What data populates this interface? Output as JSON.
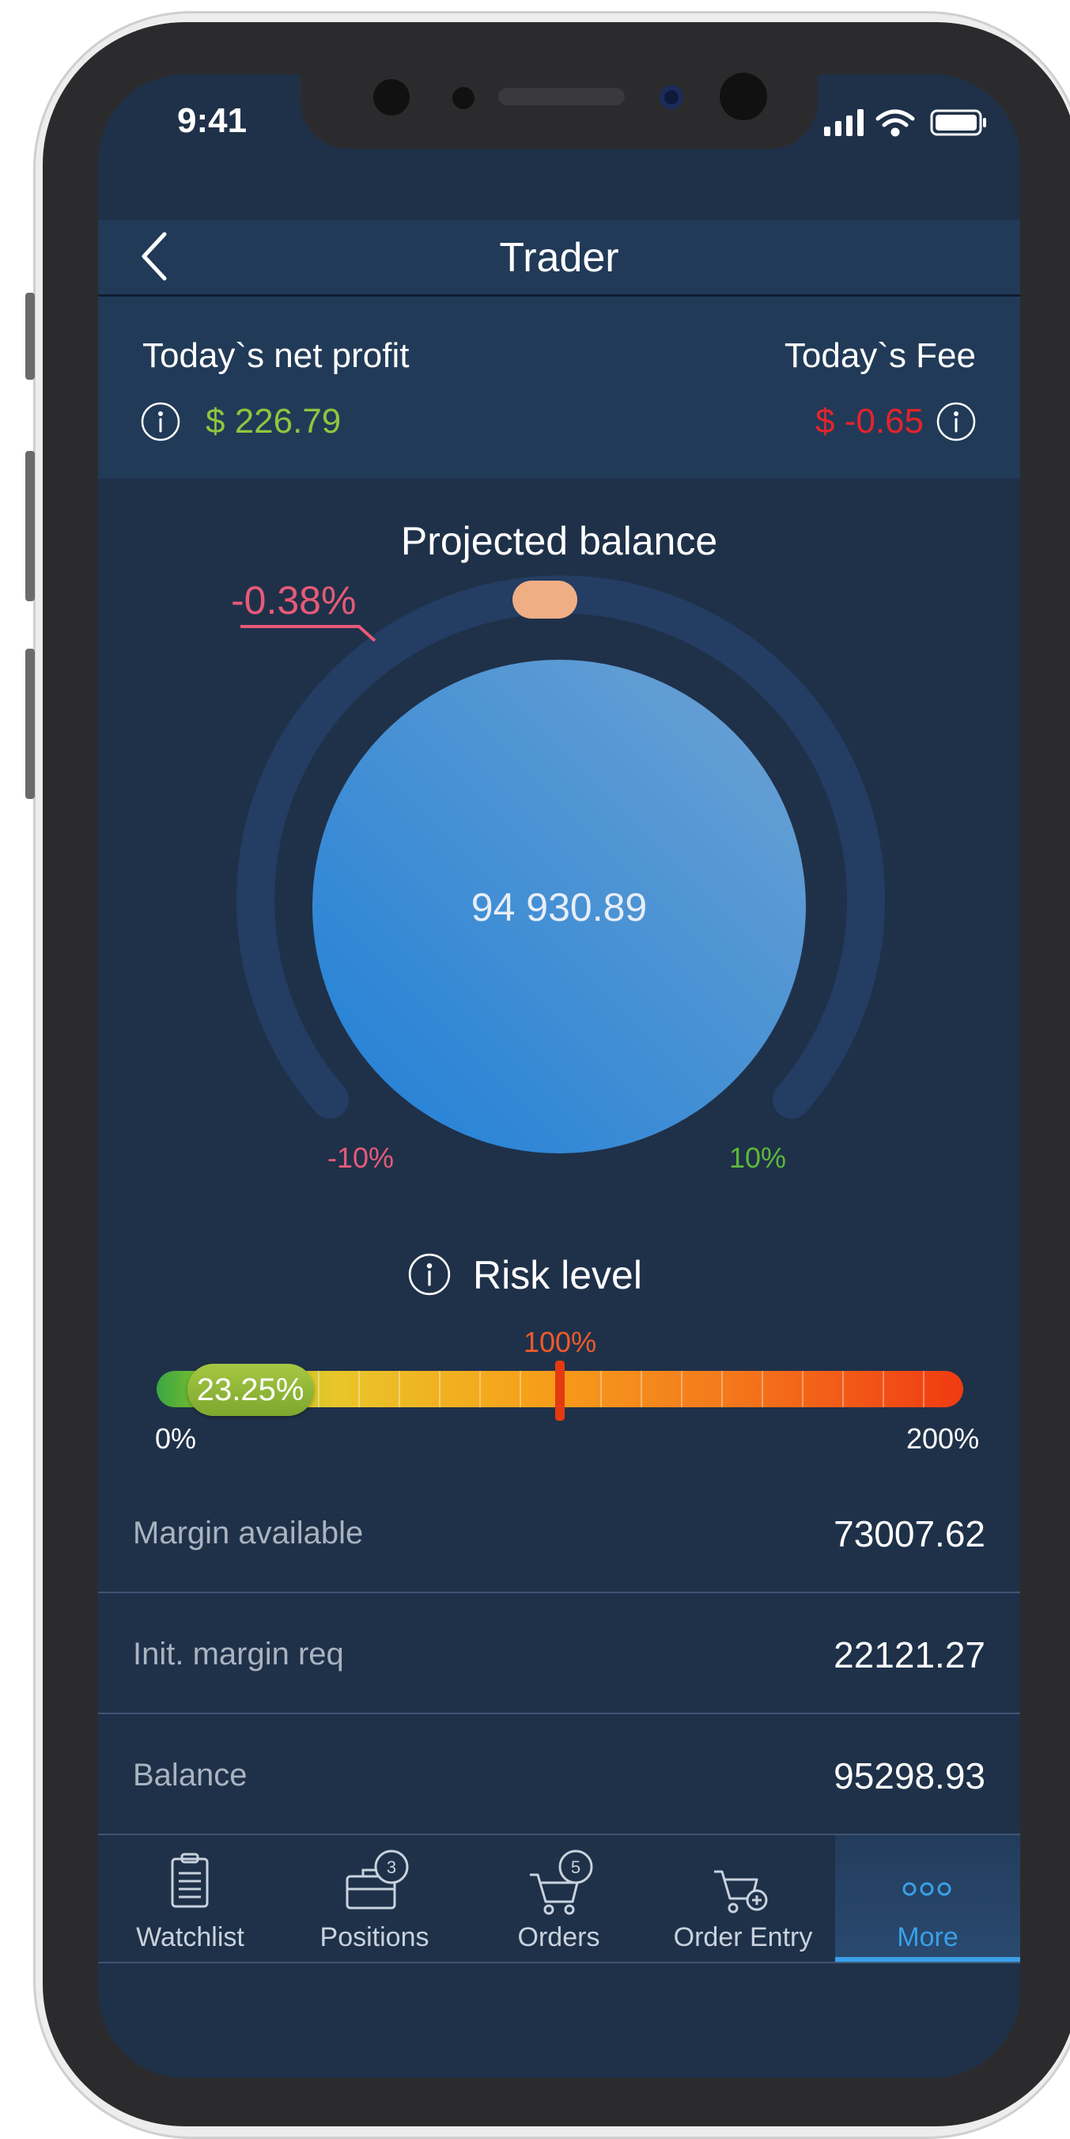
{
  "status_bar": {
    "time": "9:41"
  },
  "header": {
    "title": "Trader"
  },
  "summary": {
    "net_profit_label": "Today`s net profit",
    "net_profit_value": "$ 226.79",
    "fee_label": "Today`s Fee",
    "fee_value": "$ -0.65"
  },
  "projected": {
    "title": "Projected balance",
    "value": "94 930.89",
    "change": "-0.38%",
    "min_label": "-10%",
    "max_label": "10%"
  },
  "risk": {
    "title": "Risk level",
    "value": "23.25%",
    "min_label": "0%",
    "mid_label": "100%",
    "max_label": "200%",
    "level_fraction": 0.1163
  },
  "rows": [
    {
      "label": "Margin available",
      "value": "73007.62"
    },
    {
      "label": "Init. margin req",
      "value": "22121.27"
    },
    {
      "label": "Balance",
      "value": "95298.93"
    }
  ],
  "tabs": [
    {
      "label": "Watchlist",
      "icon": "clipboard-icon"
    },
    {
      "label": "Positions",
      "icon": "briefcase-icon",
      "badge": "3"
    },
    {
      "label": "Orders",
      "icon": "cart-icon",
      "badge": "5"
    },
    {
      "label": "Order Entry",
      "icon": "cart-add-icon"
    },
    {
      "label": "More",
      "icon": "more-icon",
      "active": true
    }
  ],
  "colors": {
    "background": "#1f3149",
    "positive": "#8ec63f",
    "negative": "#e3242b",
    "accent": "#3aa0e8",
    "gauge_marker": "#f0ae85"
  }
}
